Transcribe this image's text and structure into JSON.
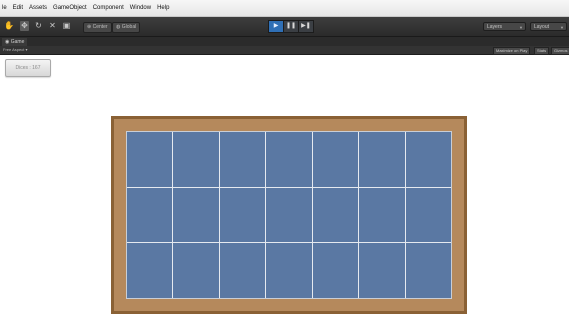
{
  "menu": {
    "items": [
      "le",
      "Edit",
      "Assets",
      "GameObject",
      "Component",
      "Window",
      "Help"
    ]
  },
  "toolbar": {
    "tools": [
      {
        "icon": "hand-icon",
        "glyph": "✋"
      },
      {
        "icon": "move-icon",
        "glyph": "✥"
      },
      {
        "icon": "rotate-icon",
        "glyph": "↻"
      },
      {
        "icon": "scale-icon",
        "glyph": "✕"
      },
      {
        "icon": "rect-icon",
        "glyph": "▣"
      }
    ],
    "pivot_label": "Center",
    "space_label": "Global",
    "playback": [
      {
        "icon": "play-icon",
        "glyph": "▶",
        "active": true
      },
      {
        "icon": "pause-icon",
        "glyph": "❚❚",
        "active": false
      },
      {
        "icon": "step-icon",
        "glyph": "▶❚",
        "active": false
      }
    ],
    "layers_label": "Layers",
    "layout_label": "Layout"
  },
  "game_view": {
    "tab_label": "Game",
    "aspect_label": "Free Aspect",
    "maximize_label": "Maximize on Play",
    "stats_label": "Stats",
    "gizmos_label": "Gizmos"
  },
  "game": {
    "button_label": "Dices : 167",
    "board": {
      "columns": 7,
      "rows": 3
    }
  },
  "colors": {
    "frame_wood": "#b5895c",
    "cell_blue": "#5a78a3",
    "grid_line": "#e5e9ef",
    "play_active": "#2f6fb5"
  }
}
